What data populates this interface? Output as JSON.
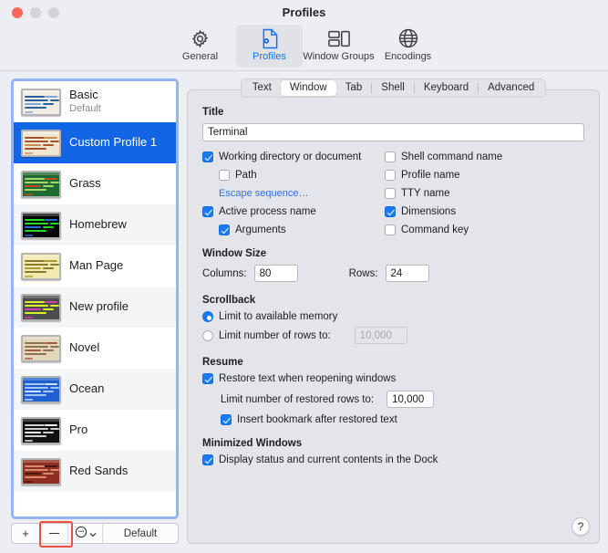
{
  "window": {
    "title": "Profiles",
    "traffic_lights": [
      "close",
      "minimize",
      "maximize"
    ]
  },
  "toolbar": {
    "items": [
      {
        "label": "General",
        "icon": "gear-icon",
        "active": false
      },
      {
        "label": "Profiles",
        "icon": "profile-document-icon",
        "active": true
      },
      {
        "label": "Window Groups",
        "icon": "window-groups-icon",
        "active": false
      },
      {
        "label": "Encodings",
        "icon": "globe-icon",
        "active": false
      }
    ]
  },
  "sidebar": {
    "profiles": [
      {
        "name": "Basic",
        "subtitle": "Default",
        "selected": false,
        "bg": "#f0ede3",
        "fg": "#2b5f9e",
        "accent": "#7ea6d8"
      },
      {
        "name": "Custom Profile 1",
        "subtitle": "",
        "selected": true,
        "bg": "#efe7d4",
        "fg": "#a4522c",
        "accent": "#cf8a4f"
      },
      {
        "name": "Grass",
        "subtitle": "",
        "selected": false,
        "bg": "#1b6b33",
        "fg": "#a8d66c",
        "accent": "#bf4d20"
      },
      {
        "name": "Homebrew",
        "subtitle": "",
        "selected": false,
        "bg": "#080808",
        "fg": "#25d825",
        "accent": "#2a6bdc"
      },
      {
        "name": "Man Page",
        "subtitle": "",
        "selected": false,
        "bg": "#f2eab3",
        "fg": "#8a7b2c",
        "accent": "#b09a2f"
      },
      {
        "name": "New profile",
        "subtitle": "",
        "selected": false,
        "bg": "#4c4c4c",
        "fg": "#d8f22a",
        "accent": "#cf3fb0"
      },
      {
        "name": "Novel",
        "subtitle": "",
        "selected": false,
        "bg": "#e2d6bd",
        "fg": "#8e7450",
        "accent": "#a8583c"
      },
      {
        "name": "Ocean",
        "subtitle": "",
        "selected": false,
        "bg": "#1f5fd0",
        "fg": "#9fc8f5",
        "accent": "#cfe3fb"
      },
      {
        "name": "Pro",
        "subtitle": "",
        "selected": false,
        "bg": "#111111",
        "fg": "#d0d0d0",
        "accent": "#f2f2f2"
      },
      {
        "name": "Red Sands",
        "subtitle": "",
        "selected": false,
        "bg": "#8f2f22",
        "fg": "#d98b6e",
        "accent": "#4a1510"
      }
    ],
    "bottom_bar": {
      "add_label": "+",
      "remove_label": "−",
      "actions_label": "⊙",
      "default_label": "Default",
      "remove_highlighted": true,
      "highlight_color": "#f2503c"
    }
  },
  "tabs": [
    {
      "label": "Text",
      "active": false
    },
    {
      "label": "Window",
      "active": true
    },
    {
      "label": "Tab",
      "active": false
    },
    {
      "label": "Shell",
      "active": false
    },
    {
      "label": "Keyboard",
      "active": false
    },
    {
      "label": "Advanced",
      "active": false
    }
  ],
  "panel": {
    "title_section": {
      "heading": "Title",
      "value": "Terminal",
      "placeholder": ""
    },
    "title_options": {
      "left": [
        {
          "label": "Working directory or document",
          "checked": true,
          "indent": 0
        },
        {
          "label": "Path",
          "checked": false,
          "indent": 1
        },
        {
          "label": "Escape sequence…",
          "link": true,
          "indent": 1
        },
        {
          "label": "Active process name",
          "checked": true,
          "indent": 0
        },
        {
          "label": "Arguments",
          "checked": true,
          "indent": 1
        }
      ],
      "right": [
        {
          "label": "Shell command name",
          "checked": false
        },
        {
          "label": "Profile name",
          "checked": false
        },
        {
          "label": "TTY name",
          "checked": false
        },
        {
          "label": "Dimensions",
          "checked": true
        },
        {
          "label": "Command key",
          "checked": false
        }
      ]
    },
    "window_size": {
      "heading": "Window Size",
      "columns_label": "Columns:",
      "columns_value": "80",
      "rows_label": "Rows:",
      "rows_value": "24"
    },
    "scrollback": {
      "heading": "Scrollback",
      "option_memory": "Limit to available memory",
      "option_rows": "Limit number of rows to:",
      "selected": "memory",
      "rows_value": "10,000",
      "rows_disabled": true
    },
    "resume": {
      "heading": "Resume",
      "restore_label": "Restore text when reopening windows",
      "restore_checked": true,
      "limit_label": "Limit number of restored rows to:",
      "limit_value": "10,000",
      "bookmark_label": "Insert bookmark after restored text",
      "bookmark_checked": true
    },
    "minimized": {
      "heading": "Minimized Windows",
      "dock_label": "Display status and current contents in the Dock",
      "dock_checked": true
    },
    "help_label": "?"
  }
}
